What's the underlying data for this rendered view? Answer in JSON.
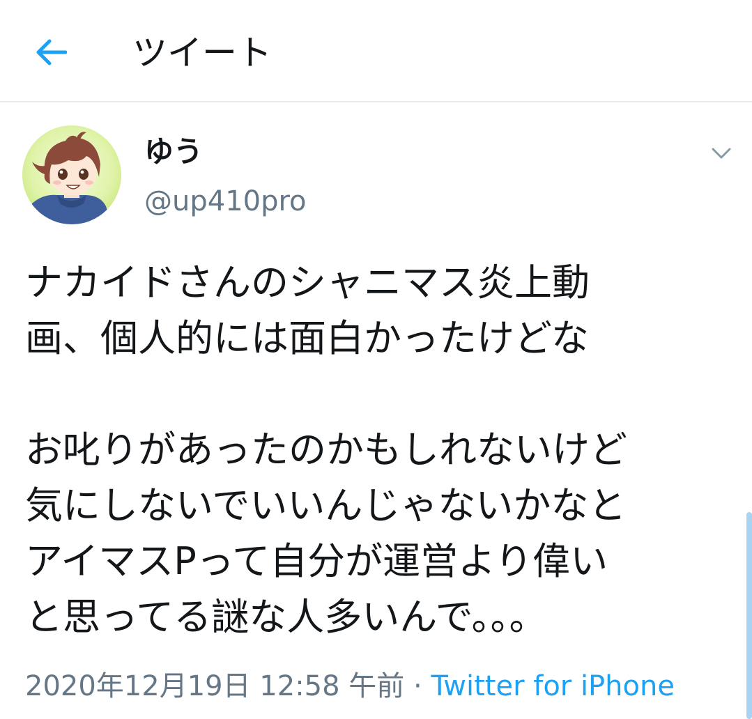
{
  "header": {
    "title": "ツイート",
    "back_icon": "arrow-left-icon",
    "accent_color": "#1da1f2"
  },
  "tweet": {
    "author": {
      "display_name": "ゆう",
      "handle": "@up410pro"
    },
    "caret_icon": "chevron-down-icon",
    "text_lines": [
      "ナカイドさんのシャニマス炎上動",
      "画、個人的には面白かったけどな",
      "",
      "お叱りがあったのかもしれないけど",
      "気にしないでいいんじゃないかなと",
      "アイマスPって自分が運営より偉い",
      "と思ってる謎な人多いんで。。。"
    ],
    "timestamp": "2020年12月19日 12:58 午前",
    "separator": "·",
    "source": "Twitter for iPhone"
  }
}
